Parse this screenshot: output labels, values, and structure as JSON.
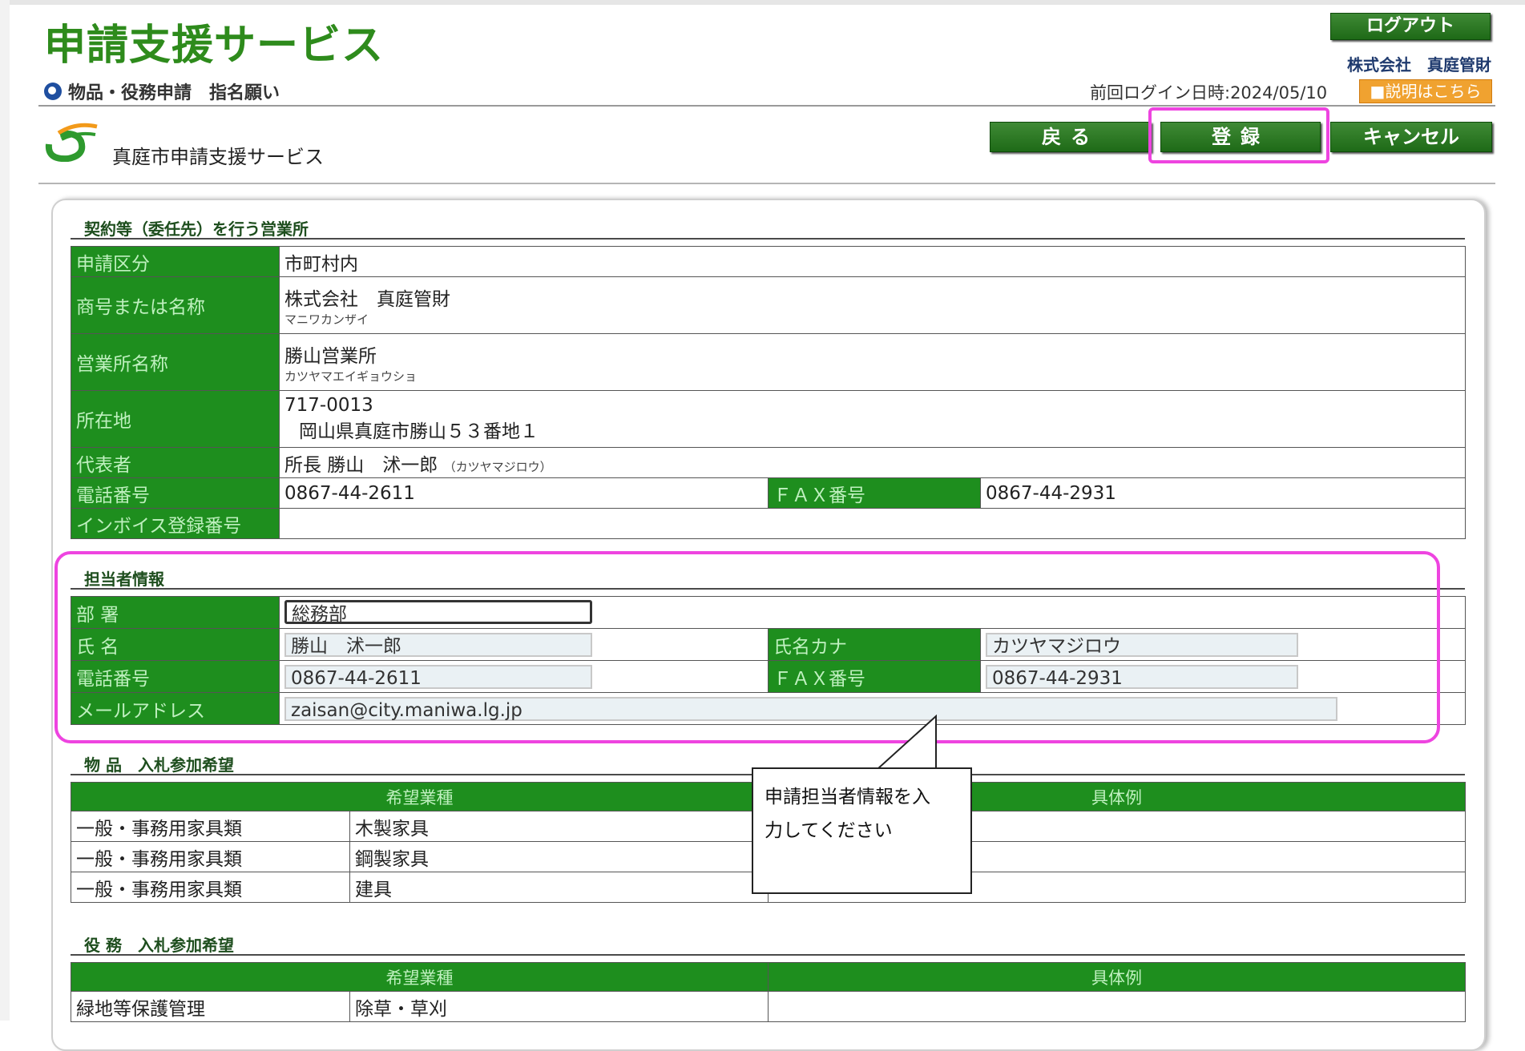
{
  "header": {
    "app_title": "申請支援サービス",
    "nav": "物品・役務申請　指名願い",
    "logout": "ログアウト",
    "company": "株式会社　真庭管財",
    "last_login": "前回ログイン日時:2024/05/10",
    "help_link": "■説明はこちら",
    "service_name": "真庭市申請支援サービス"
  },
  "actions": {
    "back": "戻る",
    "register": "登録",
    "cancel": "キャンセル"
  },
  "office": {
    "section_title": "契約等（委任先）を行う営業所",
    "rows": {
      "app_type_label": "申請区分",
      "app_type": "市町村内",
      "name_label": "商号または名称",
      "name": "株式会社　真庭管財",
      "name_kana": "マニワカンザイ",
      "branch_label": "営業所名称",
      "branch": "勝山営業所",
      "branch_kana": "カツヤマエイギョウショ",
      "address_label": "所在地",
      "postal": "717-0013",
      "address": "岡山県真庭市勝山５３番地１",
      "rep_label": "代表者",
      "rep": "所長  勝山　沭一郎",
      "rep_kana": "（カツヤマジロウ）",
      "phone_label": "電話番号",
      "phone": "0867-44-2611",
      "fax_label": "ＦＡＸ番号",
      "fax": "0867-44-2931",
      "invoice_label": "インボイス登録番号",
      "invoice": ""
    }
  },
  "contact": {
    "section_title": "担当者情報",
    "dept_label": "部 署",
    "dept": "総務部",
    "name_label": "氏 名",
    "name": "勝山　沭一郎",
    "kana_label": "氏名カナ",
    "kana": "カツヤマジロウ",
    "phone_label": "電話番号",
    "phone": "0867-44-2611",
    "fax_label": "ＦＡＸ番号",
    "fax": "0867-44-2931",
    "email_label": "メールアドレス",
    "email": "zaisan@city.maniwa.lg.jp"
  },
  "goods": {
    "section_title": "物 品　入札参加希望",
    "col_industry": "希望業種",
    "col_example": "具体例",
    "rows": [
      [
        "一般・事務用家具類",
        "木製家具",
        ""
      ],
      [
        "一般・事務用家具類",
        "鋼製家具",
        ""
      ],
      [
        "一般・事務用家具類",
        "建具",
        ""
      ]
    ]
  },
  "services": {
    "section_title": "役 務　入札参加希望",
    "col_industry": "希望業種",
    "col_example": "具体例",
    "rows": [
      [
        "緑地等保護管理",
        "除草・草刈",
        ""
      ]
    ]
  },
  "callout": {
    "line1": "申請担当者情報を入",
    "line2": "力してください"
  },
  "colors": {
    "green": "#1e8e1e",
    "highlight": "#ee44e0",
    "title_green": "#2e8b1c",
    "help_orange": "#f0a230"
  }
}
